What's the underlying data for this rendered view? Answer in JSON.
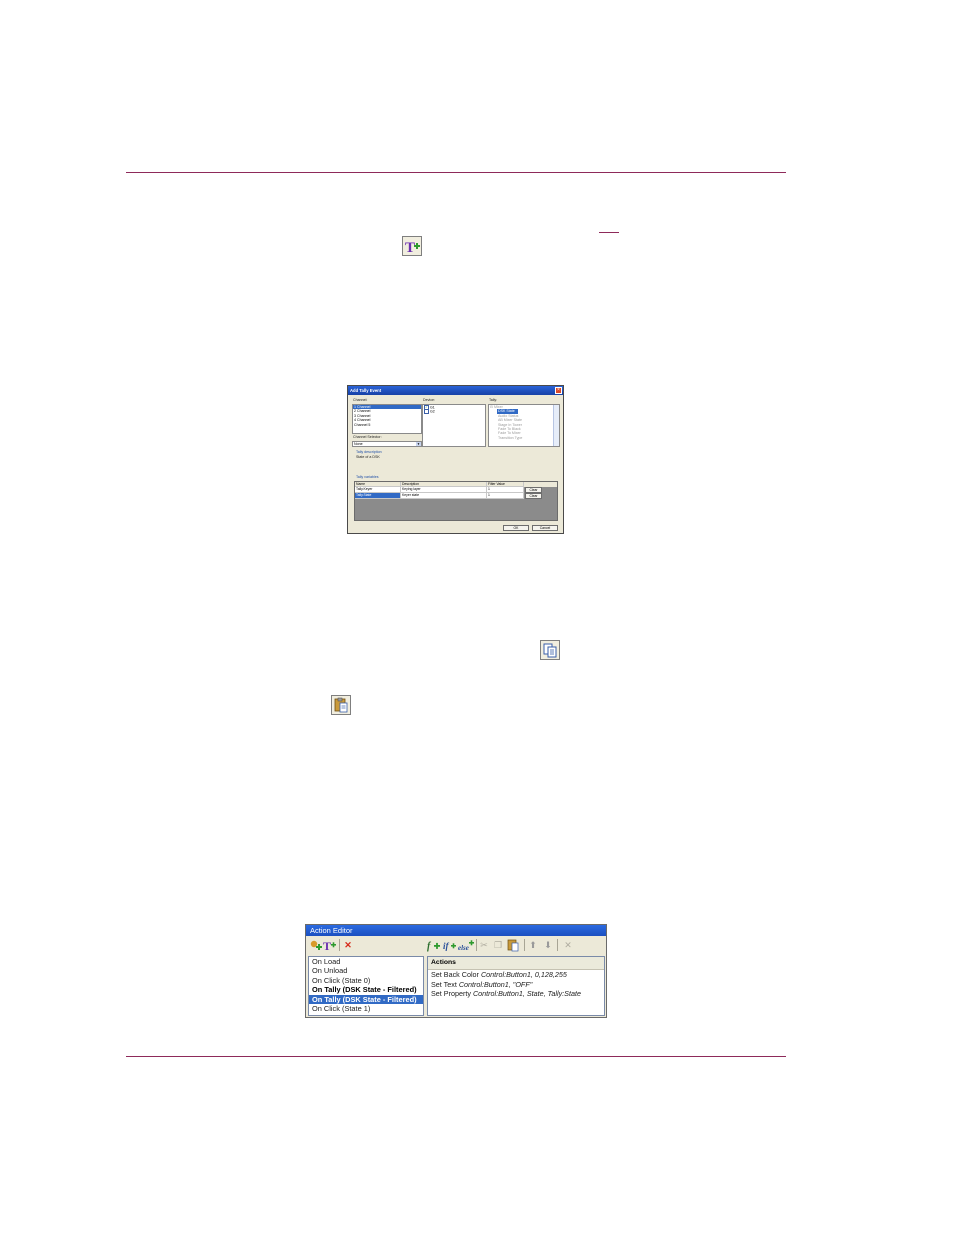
{
  "page": {
    "colors": {
      "rule": "#8e2a5a",
      "selection": "#316ac5",
      "titlebar": "#1b4fc0"
    }
  },
  "icons": {
    "tally_event": "tally-add-icon",
    "copy": "copy-icon",
    "paste": "paste-icon"
  },
  "tally_dialog": {
    "title": "Add Tally Event",
    "channel_label": "Channel:",
    "channels": [
      {
        "label": "1 Channel",
        "selected": true
      },
      {
        "label": "2 Channel"
      },
      {
        "label": "3 Channel"
      },
      {
        "label": "4 Channel"
      },
      {
        "label": "Channel 5"
      }
    ],
    "channel_selector_label": "Channel Selector:",
    "channel_selector_value": "None",
    "device_label": "Device:",
    "devices": [
      {
        "label": "G1",
        "checked": true
      },
      {
        "label": "G2",
        "checked": false
      }
    ],
    "tally_label": "Tally:",
    "tally_root": "Mixer",
    "tallies": [
      {
        "label": "DSK State",
        "selected": true
      },
      {
        "label": "Audio Status"
      },
      {
        "label": "AB Mixer State"
      },
      {
        "label": "Stage In Tower"
      },
      {
        "label": "Fade To Black"
      },
      {
        "label": "Fade To Mixer"
      },
      {
        "label": "Transition Type"
      }
    ],
    "description_label": "Tally description",
    "description_text": "State of a DSK",
    "variables_label": "Tally variables",
    "columns": [
      "Name",
      "Description",
      "Filter Value"
    ],
    "rows": [
      {
        "name": "Tally.Keyer",
        "description": "Keying layer",
        "filter": "1",
        "button": "Clear"
      },
      {
        "name": "Tally.State",
        "description": "Keyer state",
        "filter": "1",
        "button": "Clear"
      }
    ],
    "ok": "OK",
    "cancel": "Cancel"
  },
  "action_editor": {
    "title": "Action Editor",
    "actions_header": "Actions",
    "events": [
      {
        "label": "On Load",
        "style": "normal"
      },
      {
        "label": "On Unload",
        "style": "normal"
      },
      {
        "label": "On Click (State 0)",
        "style": "normal"
      },
      {
        "label": "On Tally (DSK State - Filtered)",
        "style": "bold"
      },
      {
        "label": "On Tally (DSK State - Filtered)",
        "style": "selected"
      },
      {
        "label": "On Click (State 1)",
        "style": "normal"
      }
    ],
    "actions": [
      {
        "name": "Set Back Color",
        "args": "Control:Button1,  0,128,255"
      },
      {
        "name": "Set Text",
        "args": "Control:Button1,  \"OFF\""
      },
      {
        "name": "Set Property",
        "args": "Control:Button1,  State,  Tally:State"
      }
    ]
  }
}
